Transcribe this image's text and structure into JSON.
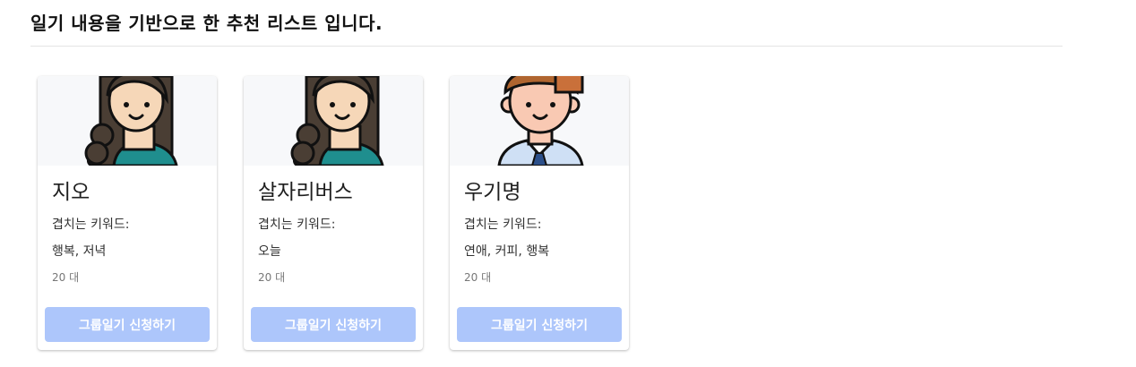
{
  "header": {
    "title": "일기 내용을 기반으로 한 추천 리스트 입니다."
  },
  "colors": {
    "button_bg": "#adc6fb",
    "media_bg": "#f7f8fa"
  },
  "cards": [
    {
      "avatar": "girl-avatar-icon",
      "name": "지오",
      "keywords_label": "겹치는 키워드:",
      "keywords": "행복, 저녁",
      "age": "20 대",
      "button_label": "그룹일기 신청하기"
    },
    {
      "avatar": "girl-avatar-icon",
      "name": "살자리버스",
      "keywords_label": "겹치는 키워드:",
      "keywords": "오늘",
      "age": "20 대",
      "button_label": "그룹일기 신청하기"
    },
    {
      "avatar": "boy-avatar-icon",
      "name": "우기명",
      "keywords_label": "겹치는 키워드:",
      "keywords": "연애, 커피, 행복",
      "age": "20 대",
      "button_label": "그룹일기 신청하기"
    }
  ]
}
